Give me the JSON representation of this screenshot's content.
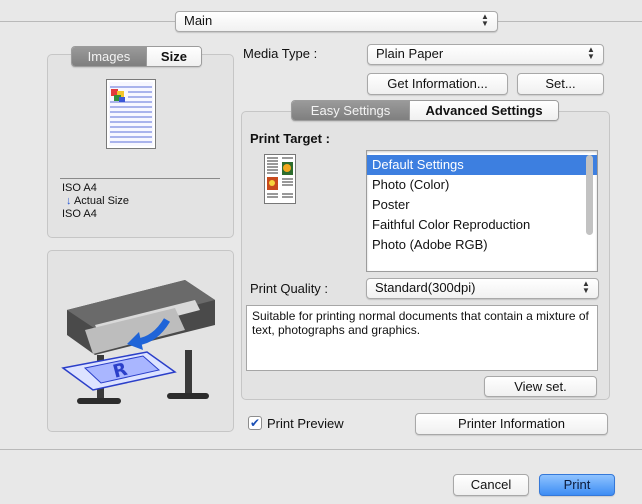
{
  "top_popup": {
    "value": "Main"
  },
  "preview_panel": {
    "tabs": [
      {
        "label": "Images"
      },
      {
        "label": "Size"
      }
    ],
    "selected_tab": "Images",
    "paper_in": "ISO A4",
    "scale_mode": "Actual Size",
    "paper_out": "ISO A4"
  },
  "media_type": {
    "label": "Media Type :",
    "value": "Plain Paper"
  },
  "buttons": {
    "get_information": "Get Information...",
    "set": "Set...",
    "view_set": "View set.",
    "printer_information": "Printer Information",
    "cancel": "Cancel",
    "print": "Print"
  },
  "settings_tabs": [
    {
      "label": "Easy Settings"
    },
    {
      "label": "Advanced Settings"
    }
  ],
  "selected_settings_tab": "Easy Settings",
  "print_target": {
    "label": "Print Target :",
    "options": [
      {
        "label": "Default Settings",
        "selected": true
      },
      {
        "label": "Photo (Color)",
        "selected": false
      },
      {
        "label": "Poster",
        "selected": false
      },
      {
        "label": "Faithful Color Reproduction",
        "selected": false
      },
      {
        "label": "Photo (Adobe RGB)",
        "selected": false
      }
    ]
  },
  "print_quality": {
    "label": "Print Quality :",
    "value": "Standard(300dpi)"
  },
  "description": "Suitable for printing normal documents that contain a mixture of text, photographs and graphics.",
  "print_preview": {
    "label": "Print Preview",
    "checked": true
  },
  "colors": {
    "accent": "#3d7fe0",
    "tab_selected": "#8a8a8a",
    "background": "#e8e8e8"
  }
}
